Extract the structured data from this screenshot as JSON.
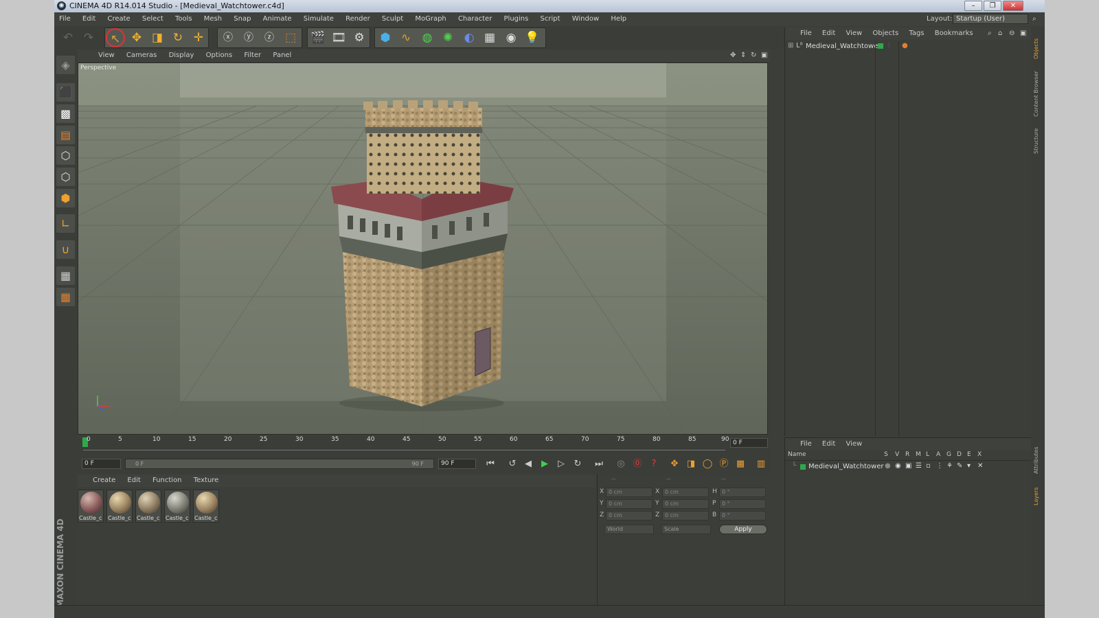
{
  "window": {
    "title": "CINEMA 4D R14.014 Studio - [Medieval_Watchtower.c4d]",
    "layout_label": "Layout:",
    "layout_value": "Startup (User)"
  },
  "menubar": [
    "File",
    "Edit",
    "Create",
    "Select",
    "Tools",
    "Mesh",
    "Snap",
    "Animate",
    "Simulate",
    "Render",
    "Sculpt",
    "MoGraph",
    "Character",
    "Plugins",
    "Script",
    "Window",
    "Help"
  ],
  "viewport": {
    "menu": [
      "View",
      "Cameras",
      "Display",
      "Options",
      "Filter",
      "Panel"
    ],
    "label": "Perspective"
  },
  "timeline": {
    "ticks": [
      "0",
      "5",
      "10",
      "15",
      "20",
      "25",
      "30",
      "35",
      "40",
      "45",
      "50",
      "55",
      "60",
      "65",
      "70",
      "75",
      "80",
      "85",
      "90"
    ],
    "current_frame": "0 F",
    "start_field": "0 F",
    "range_start": "0 F",
    "range_end": "90 F",
    "end_field": "90 F"
  },
  "materials": {
    "menu": [
      "Create",
      "Edit",
      "Function",
      "Texture"
    ],
    "items": [
      "Castle_c",
      "Castle_c",
      "Castle_c",
      "Castle_c",
      "Castle_c"
    ]
  },
  "coords": {
    "header": [
      "--",
      "--",
      "--"
    ],
    "col1": [
      {
        "label": "X",
        "value": "0 cm"
      },
      {
        "label": "Y",
        "value": "0 cm"
      },
      {
        "label": "Z",
        "value": "0 cm"
      }
    ],
    "col2": [
      {
        "label": "X",
        "value": "0 cm"
      },
      {
        "label": "Y",
        "value": "0 cm"
      },
      {
        "label": "Z",
        "value": "0 cm"
      }
    ],
    "col3": [
      {
        "label": "H",
        "value": "0 °"
      },
      {
        "label": "P",
        "value": "0 °"
      },
      {
        "label": "B",
        "value": "0 °"
      }
    ],
    "world": "World",
    "scale": "Scale",
    "apply": "Apply"
  },
  "objects": {
    "menu": [
      "File",
      "Edit",
      "View",
      "Objects",
      "Tags",
      "Bookmarks"
    ],
    "root": "Medieval_Watchtower"
  },
  "attributes": {
    "menu": [
      "File",
      "Edit",
      "View"
    ],
    "columns": [
      "Name",
      "S",
      "V",
      "R",
      "M",
      "L",
      "A",
      "G",
      "D",
      "E",
      "X"
    ],
    "row": "Medieval_Watchtower"
  },
  "side_tabs": [
    "Objects",
    "Content Browser",
    "Structure",
    "Attributes",
    "Layers"
  ],
  "brand": "MAXON CINEMA 4D",
  "colors": {
    "accent_green": "#2fa84a",
    "panel": "#3c3e3a",
    "viewport": "#6e7366"
  }
}
